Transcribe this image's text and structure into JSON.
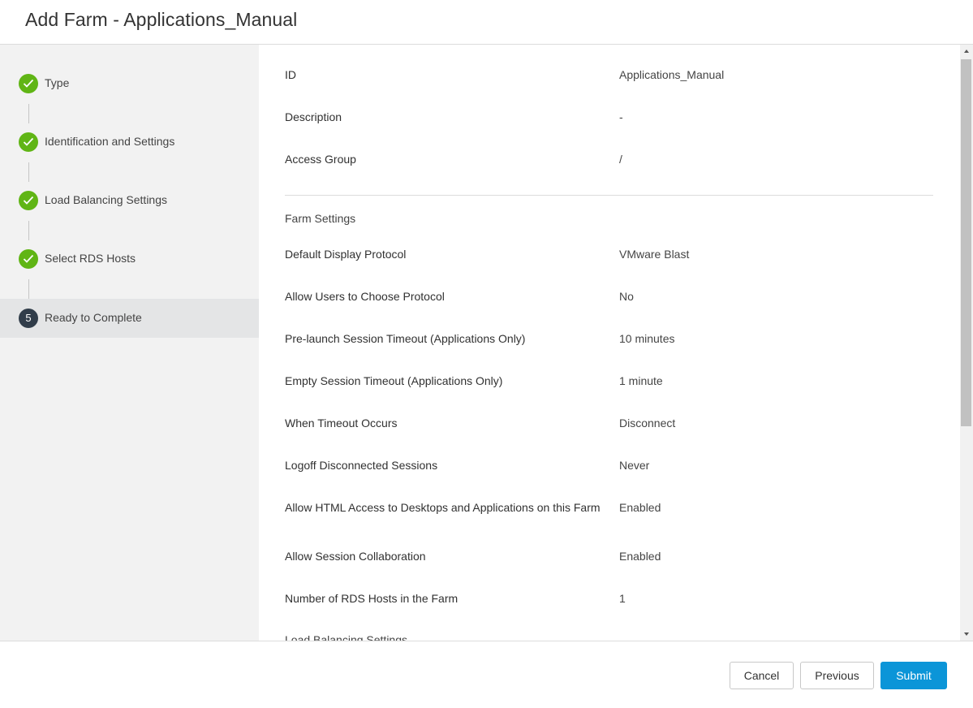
{
  "dialog": {
    "title": "Add Farm - Applications_Manual"
  },
  "steps": [
    {
      "label": "Type",
      "status": "complete"
    },
    {
      "label": "Identification and Settings",
      "status": "complete"
    },
    {
      "label": "Load Balancing Settings",
      "status": "complete"
    },
    {
      "label": "Select RDS Hosts",
      "status": "complete"
    },
    {
      "label": "Ready to Complete",
      "status": "current",
      "number": "5"
    }
  ],
  "summary": {
    "general": [
      {
        "key": "ID",
        "value": "Applications_Manual"
      },
      {
        "key": "Description",
        "value": "-"
      },
      {
        "key": "Access Group",
        "value": "/"
      }
    ],
    "farm_settings_title": "Farm Settings",
    "farm_settings": [
      {
        "key": "Default Display Protocol",
        "value": "VMware Blast"
      },
      {
        "key": "Allow Users to Choose Protocol",
        "value": "No"
      },
      {
        "key": "Pre-launch Session Timeout (Applications Only)",
        "value": "10 minutes"
      },
      {
        "key": "Empty Session Timeout (Applications Only)",
        "value": "1 minute"
      },
      {
        "key": "When Timeout Occurs",
        "value": "Disconnect"
      },
      {
        "key": "Logoff Disconnected Sessions",
        "value": "Never"
      },
      {
        "key": "Allow HTML Access to Desktops and Applications on this Farm",
        "value": "Enabled"
      },
      {
        "key": "Allow Session Collaboration",
        "value": "Enabled"
      },
      {
        "key": "Number of RDS Hosts in the Farm",
        "value": "1"
      }
    ],
    "load_balancing_title": "Load Balancing Settings"
  },
  "footer": {
    "cancel_label": "Cancel",
    "previous_label": "Previous",
    "submit_label": "Submit"
  },
  "colors": {
    "complete": "#60b515",
    "current": "#313d4a",
    "primary_button": "#0b95d8"
  }
}
